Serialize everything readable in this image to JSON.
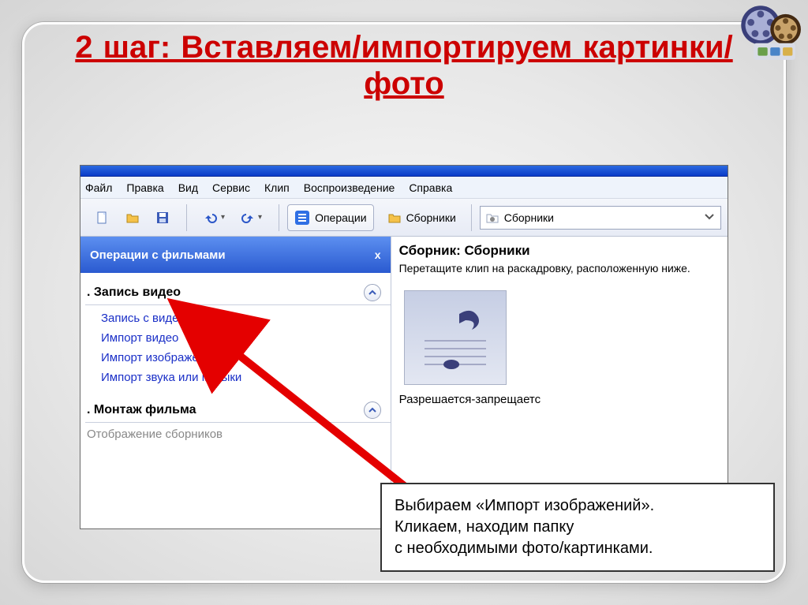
{
  "slide_title": "2 шаг: Вставляем/импортируем картинки/фото",
  "menubar": [
    "Файл",
    "Правка",
    "Вид",
    "Сервис",
    "Клип",
    "Воспроизведение",
    "Справка"
  ],
  "toolbar": {
    "operations": "Операции",
    "collections": "Сборники",
    "combo_value": "Сборники"
  },
  "pane": {
    "title": "Операции с фильмами",
    "close": "x",
    "section1": {
      "num": ". ",
      "label": "Запись видео"
    },
    "links1": [
      "Запись с видеоустройства",
      "Импорт видео",
      "Импорт изображений",
      "Импорт звука или музыки"
    ],
    "section2": {
      "label": ". Монтаж фильма"
    },
    "dim_link": "Отображение сборников"
  },
  "right": {
    "title": "Сборник: Сборники",
    "hint": "Перетащите клип на раскадровку, расположенную ниже.",
    "caption": "Разрешается-запрещаетс"
  },
  "callout": {
    "l1": "Выбираем «Импорт изображений».",
    "l2": "Кликаем, находим папку",
    "l3": "с необходимыми фото/картинками."
  }
}
